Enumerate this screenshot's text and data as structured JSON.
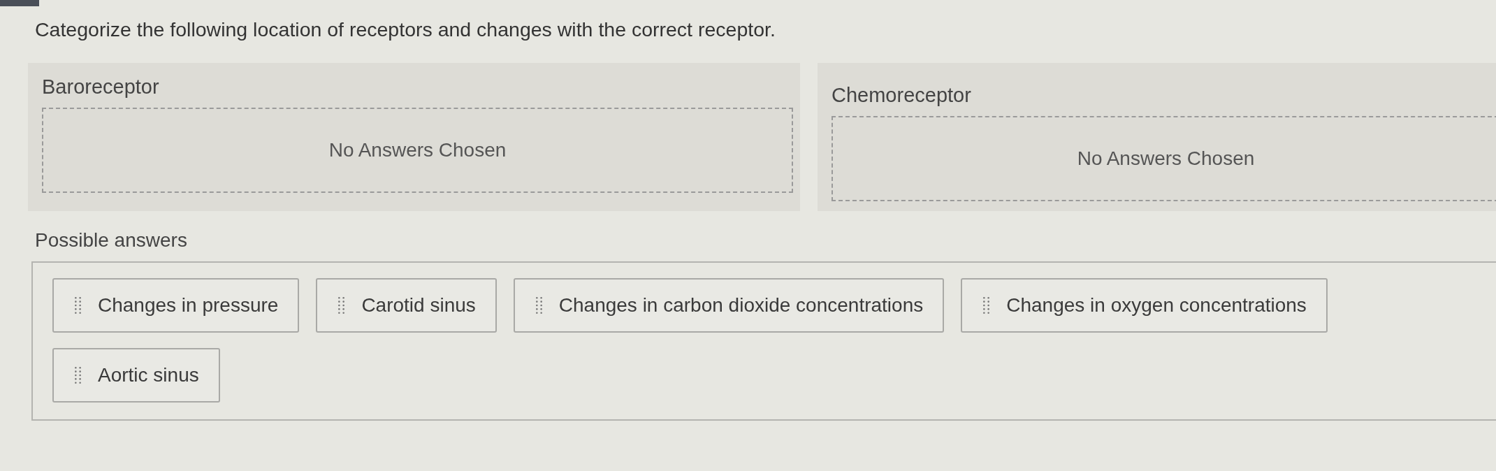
{
  "question": "Categorize the following location of receptors and changes with the correct receptor.",
  "categories": [
    {
      "label": "Baroreceptor",
      "placeholder": "No Answers Chosen"
    },
    {
      "label": "Chemoreceptor",
      "placeholder": "No Answers Chosen"
    }
  ],
  "answers": {
    "label": "Possible answers",
    "items": [
      "Changes in pressure",
      "Carotid sinus",
      "Changes in carbon dioxide concentrations",
      "Changes in oxygen concentrations",
      "Aortic sinus"
    ]
  }
}
